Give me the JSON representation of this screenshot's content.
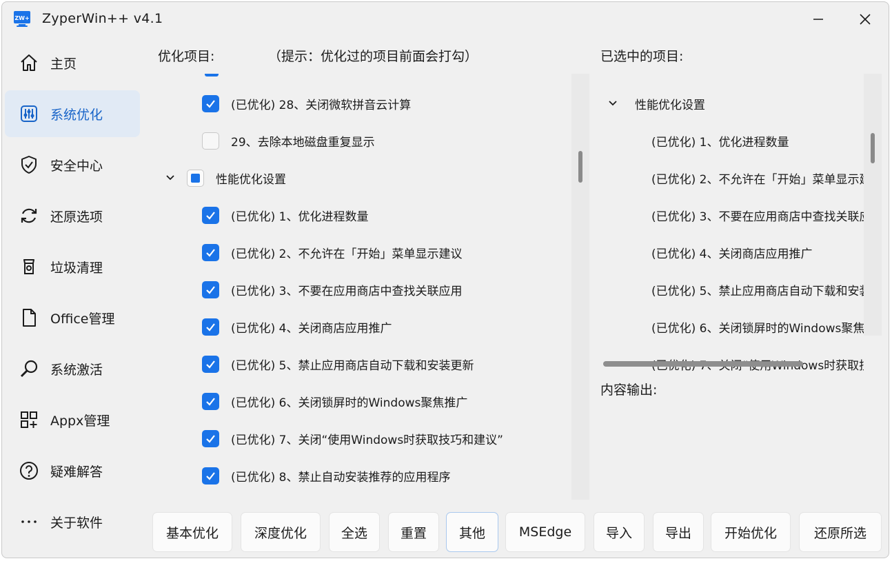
{
  "window": {
    "title": "ZyperWin++ v4.1",
    "icon_text": "ZW+",
    "controls": {
      "minimize": "minimize-icon",
      "close": "close-icon"
    }
  },
  "sidebar": {
    "items": [
      {
        "label": "主页",
        "icon": "home-icon",
        "active": false
      },
      {
        "label": "系统优化",
        "icon": "sliders-icon",
        "active": true
      },
      {
        "label": "安全中心",
        "icon": "shield-check-icon",
        "active": false
      },
      {
        "label": "还原选项",
        "icon": "refresh-icon",
        "active": false
      },
      {
        "label": "垃圾清理",
        "icon": "trash-icon",
        "active": false
      },
      {
        "label": "Office管理",
        "icon": "document-icon",
        "active": false
      },
      {
        "label": "系统激活",
        "icon": "key-search-icon",
        "active": false
      },
      {
        "label": "Appx管理",
        "icon": "apps-grid-icon",
        "active": false
      },
      {
        "label": "疑难解答",
        "icon": "help-circle-icon",
        "active": false
      },
      {
        "label": "关于软件",
        "icon": "more-dots-icon",
        "active": false
      }
    ]
  },
  "options": {
    "header": "优化项目:",
    "hint": "（提示：优化过的项目前面会打勾）",
    "rows": [
      {
        "label": "(已优化) 28、关闭微软拼音云计算",
        "state": "checked",
        "group": false
      },
      {
        "label": "29、去除本地磁盘重复显示",
        "state": "unchecked",
        "group": false
      },
      {
        "label": "性能优化设置",
        "state": "partial",
        "group": true
      },
      {
        "label": "(已优化) 1、优化进程数量",
        "state": "checked",
        "group": false
      },
      {
        "label": "(已优化) 2、不允许在「开始」菜单显示建议",
        "state": "checked",
        "group": false
      },
      {
        "label": "(已优化) 3、不要在应用商店中查找关联应用",
        "state": "checked",
        "group": false
      },
      {
        "label": "(已优化) 4、关闭商店应用推广",
        "state": "checked",
        "group": false
      },
      {
        "label": "(已优化) 5、禁止应用商店自动下载和安装更新",
        "state": "checked",
        "group": false
      },
      {
        "label": "(已优化) 6、关闭锁屏时的Windows聚焦推广",
        "state": "checked",
        "group": false
      },
      {
        "label": "(已优化) 7、关闭“使用Windows时获取技巧和建议”",
        "state": "checked",
        "group": false
      },
      {
        "label": "(已优化) 8、禁止自动安装推荐的应用程序",
        "state": "checked",
        "group": false
      }
    ]
  },
  "selected": {
    "header": "已选中的项目:",
    "group": "性能优化设置",
    "items": [
      "(已优化) 1、优化进程数量",
      "(已优化) 2、不允许在「开始」菜单显示建",
      "(已优化) 3、不要在应用商店中查找关联应",
      "(已优化) 4、关闭商店应用推广",
      "(已优化) 5、禁止应用商店自动下载和安装",
      "(已优化) 6、关闭锁屏时的Windows聚焦推",
      "(已优化) 7、关闭“使用Windows时获取技"
    ]
  },
  "output": {
    "header": "内容输出:"
  },
  "buttons": [
    {
      "label": "基本优化",
      "name": "basic-optimize-button"
    },
    {
      "label": "深度优化",
      "name": "deep-optimize-button"
    },
    {
      "label": "全选",
      "name": "select-all-button"
    },
    {
      "label": "重置",
      "name": "reset-button"
    },
    {
      "label": "其他",
      "name": "other-button"
    },
    {
      "label": "MSEdge",
      "name": "msedge-button"
    },
    {
      "label": "导入",
      "name": "import-button"
    },
    {
      "label": "导出",
      "name": "export-button"
    },
    {
      "label": "开始优化",
      "name": "start-optimize-button"
    },
    {
      "label": "还原所选",
      "name": "restore-selected-button"
    }
  ],
  "colors": {
    "accent": "#1a73e8",
    "nav_active_bg": "#e1eaf5",
    "window_bg": "#f0f0f0"
  }
}
